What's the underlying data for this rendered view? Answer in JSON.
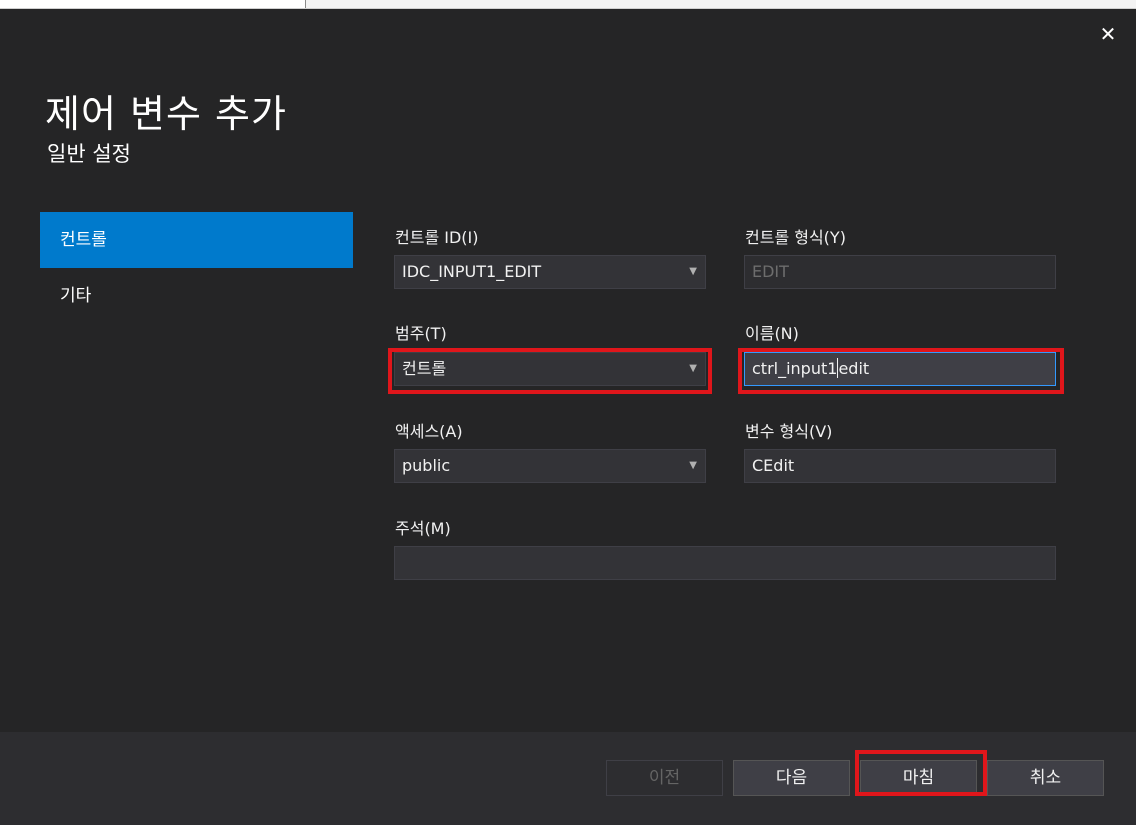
{
  "window": {
    "close_glyph": "✕"
  },
  "header": {
    "title": "제어 변수 추가",
    "subtitle": "일반 설정"
  },
  "sidebar": {
    "items": [
      {
        "label": "컨트롤",
        "selected": true
      },
      {
        "label": "기타",
        "selected": false
      }
    ]
  },
  "form": {
    "control_id": {
      "label": "컨트롤 ID(I)",
      "value": "IDC_INPUT1_EDIT"
    },
    "control_type": {
      "label": "컨트롤 형식(Y)",
      "value": "EDIT"
    },
    "category": {
      "label": "범주(T)",
      "value": "컨트롤"
    },
    "name": {
      "label": "이름(N)",
      "value_before_cursor": "ctrl_input1",
      "value_after_cursor": "edit"
    },
    "access": {
      "label": "액세스(A)",
      "value": "public"
    },
    "variable_type": {
      "label": "변수 형식(V)",
      "value": "CEdit"
    },
    "comment": {
      "label": "주석(M)",
      "value": ""
    }
  },
  "footer": {
    "prev_label": "이전",
    "next_label": "다음",
    "finish_label": "마침",
    "cancel_label": "취소"
  },
  "icons": {
    "dropdown": "chevron-down-icon",
    "close": "close-icon"
  },
  "colors": {
    "accent": "#007acc",
    "highlight": "#e0161b",
    "background": "#252526"
  }
}
